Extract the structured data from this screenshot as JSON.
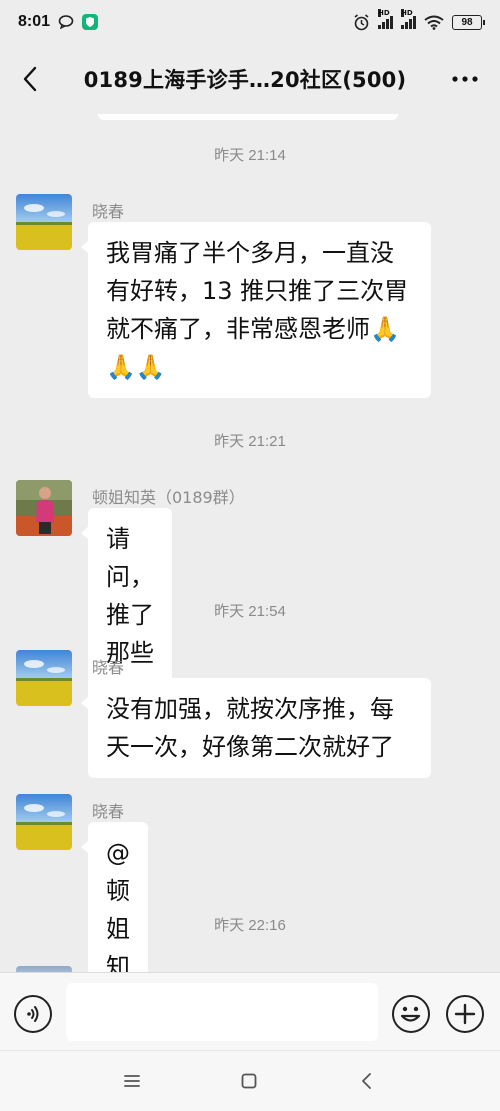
{
  "status_bar": {
    "time": "8:01",
    "battery": "98",
    "left_icons": [
      "chat-bubble-icon",
      "shield-app-icon"
    ],
    "right_icons": [
      "alarm-icon",
      "signal-hd-icon",
      "signal-hd-icon",
      "wifi-icon",
      "battery-icon"
    ]
  },
  "header": {
    "title": "0189上海手诊手…20社区(500)",
    "back_icon": "chevron-left-icon",
    "more_icon": "more-dots-icon"
  },
  "chat": {
    "timestamps": [
      "昨天 21:14",
      "昨天 21:21",
      "昨天 21:54",
      "昨天 22:16"
    ],
    "messages": [
      {
        "sender": "晓春",
        "lines": [
          "我胃痛了半个多月，一直没",
          "有好转，13 推只推了三次胃",
          "就不痛了，非常感恩老师🙏",
          "🙏🙏"
        ]
      },
      {
        "sender": "顿姐知英（0189群）",
        "lines": [
          "请问，推了那些加强穴？"
        ]
      },
      {
        "sender": "晓春",
        "lines": [
          "没有加强，就按次序推，每",
          "天一次，好像第二次就好了"
        ]
      },
      {
        "sender": "晓春",
        "lines": [
          "@顿姐知英"
        ]
      }
    ]
  },
  "input_bar": {
    "voice_icon": "voice-icon",
    "input_value": "",
    "emoji_icon": "emoji-icon",
    "plus_icon": "plus-icon"
  },
  "system_nav": {
    "icons": [
      "menu-icon",
      "home-square-icon",
      "back-triangle-icon"
    ]
  },
  "colors": {
    "background": "#ededed",
    "bubble": "#ffffff",
    "meta_text": "#8a8a8a"
  }
}
